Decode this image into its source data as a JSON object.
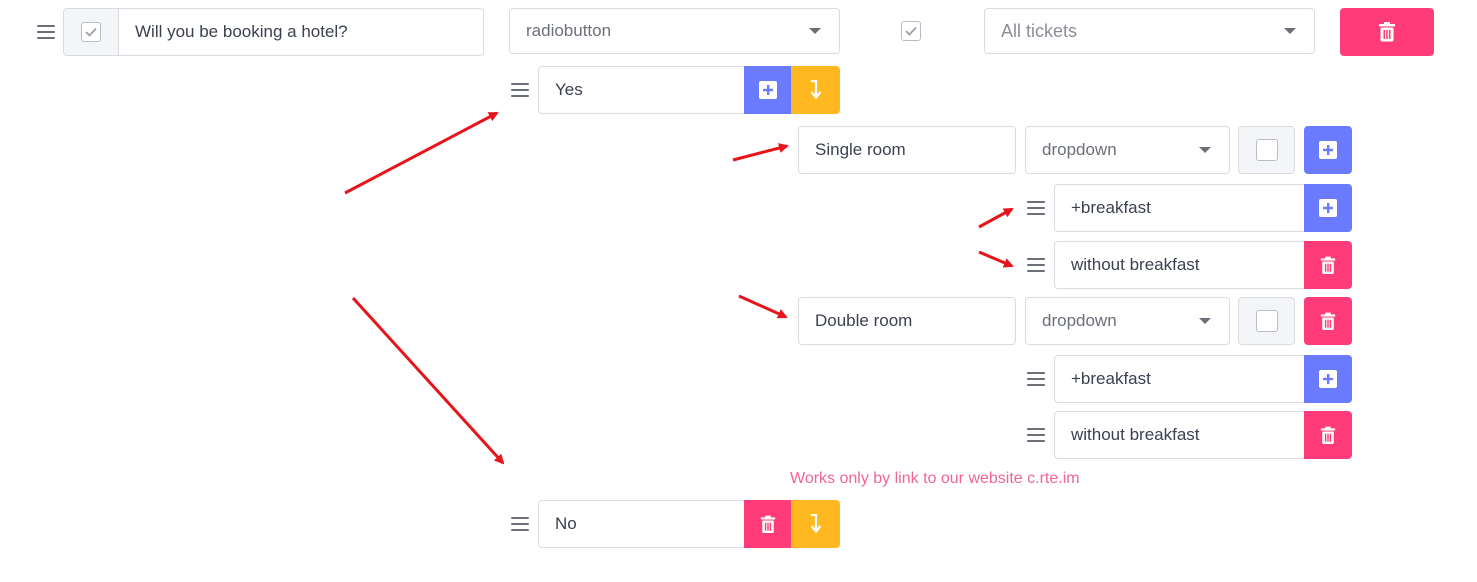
{
  "question": {
    "text": "Will you be booking a hotel?",
    "type": "radiobutton",
    "tickets": "All tickets"
  },
  "options": [
    {
      "label": "Yes",
      "sub_items": [
        {
          "label": "Single room",
          "type": "dropdown",
          "choices": [
            "+breakfast",
            "without breakfast"
          ]
        },
        {
          "label": "Double room",
          "type": "dropdown",
          "choices": [
            "+breakfast",
            "without breakfast"
          ]
        }
      ]
    },
    {
      "label": "No"
    }
  ],
  "note": "Works only by link to our website c.rte.im",
  "colors": {
    "blue": "#6a7bff",
    "pink": "#ff3b7a",
    "yellow": "#ffb81f",
    "arrow": "#e8141b",
    "note": "#f06690"
  },
  "icons": {
    "drag": "drag-handle-icon",
    "check": "check-icon",
    "add": "plus-square-icon",
    "delete": "trash-icon",
    "branch": "branch-arrow-icon",
    "caret": "caret-down-icon"
  }
}
